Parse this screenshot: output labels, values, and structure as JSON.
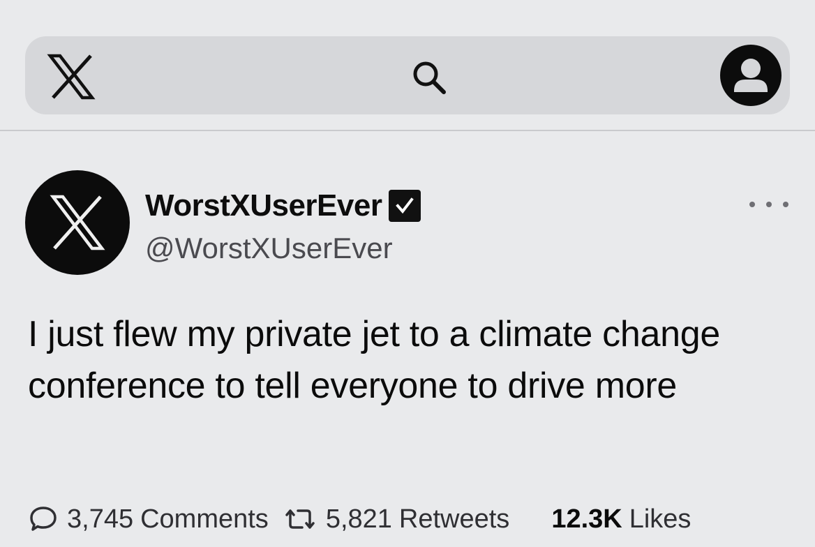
{
  "topbar": {
    "logo_icon": "x-logo-icon",
    "search_icon": "search-icon",
    "account_icon": "account-icon"
  },
  "tweet": {
    "display_name": "WorstXUserEver",
    "verified_icon": "verified-check-icon",
    "handle": "@WorstXUserEver",
    "more_icon": "more-options-icon",
    "text": "I just flew my private jet to a climate change conference to tell everyone to drive more"
  },
  "stats": {
    "comments_count": "3,745",
    "comments_label": "Comments",
    "retweets_count": "5,821",
    "retweets_label": "Retweets",
    "likes_count": "12.3K",
    "likes_label": "Likes"
  },
  "colors": {
    "background": "#e9eaec",
    "topbar": "#d6d7da",
    "text": "#0b0b0b",
    "secondary_text": "#4a4a4f"
  }
}
